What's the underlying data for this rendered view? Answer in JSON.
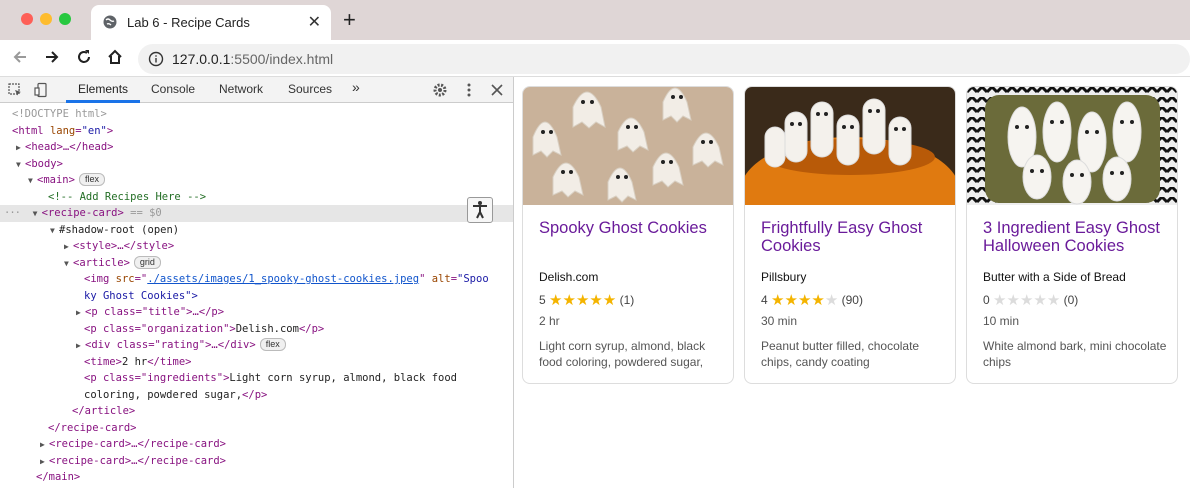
{
  "browser": {
    "tab_title": "Lab 6 - Recipe Cards",
    "new_tab": "+",
    "url_host": "127.0.0.1",
    "url_rest": ":5500/index.html",
    "traffic_lights": [
      "#fe5f57",
      "#febc2e",
      "#28c840"
    ]
  },
  "devtools": {
    "tabs": [
      "Elements",
      "Console",
      "Network",
      "Sources"
    ],
    "more": "»",
    "tree": {
      "doctype": "<!DOCTYPE html>",
      "html_open": "<html",
      "html_attr": "lang",
      "html_val": "\"en\"",
      "head": "<head>…</head>",
      "body": "<body>",
      "main": "<main>",
      "flex": "flex",
      "grid": "grid",
      "comment": "<!-- Add Recipes Here -->",
      "recipe_card": "<recipe-card>",
      "selected_suffix": "== $0",
      "shadow_root": "#shadow-root (open)",
      "style": "<style>…</style>",
      "article": "<article>",
      "img_open": "<img",
      "img_src_attr": "src",
      "img_src_val": "./assets/images/1_spooky-ghost-cookies.jpeg",
      "img_alt_attr": "alt",
      "img_alt_val_1": "\"Spoo",
      "img_alt_val_2": "ky Ghost Cookies\">",
      "p_title_open": "<p class=\"title\">…</p>",
      "p_org_open": "<p class=\"organization\">",
      "p_org_text": "Delish.com",
      "p_close": "</p>",
      "div_rating": "<div class=\"rating\">…</div>",
      "time_open": "<time>",
      "time_text": "2 hr",
      "time_close": "</time>",
      "p_ingr_open": "<p class=\"ingredients\">",
      "p_ingr_text_1": "Light corn syrup, almond, black food",
      "p_ingr_text_2": "coloring, powdered sugar,",
      "article_close": "</article>",
      "recipe_card_close": "</recipe-card>",
      "recipe_card_collapsed": "<recipe-card>…</recipe-card>",
      "main_close": "</main>"
    }
  },
  "recipes": [
    {
      "title": "Spooky Ghost Cookies",
      "organization": "Delish.com",
      "rating": "5",
      "stars": "★★★★★",
      "reviews": "(1)",
      "time": "2 hr",
      "ingredients": "Light corn syrup, almond, black food coloring, powdered sugar,",
      "filled": 5
    },
    {
      "title": "Frightfully Easy Ghost Cookies",
      "organization": "Pillsbury",
      "rating": "4",
      "stars": "★★★★★",
      "reviews": "(90)",
      "time": "30 min",
      "ingredients": "Peanut butter filled, chocolate chips, candy coating",
      "filled": 4
    },
    {
      "title": "3 Ingredient Easy Ghost Halloween Cookies",
      "organization": "Butter with a Side of Bread",
      "rating": "0",
      "stars": "★★★★★",
      "reviews": "(0)",
      "time": "10 min",
      "ingredients": "White almond bark, mini chocolate chips",
      "filled": 0
    }
  ],
  "colors": {
    "title": "#6a1b9a",
    "star_on": "#f4b400",
    "star_off": "#dcdcdc",
    "accent": "#1a73e8"
  }
}
